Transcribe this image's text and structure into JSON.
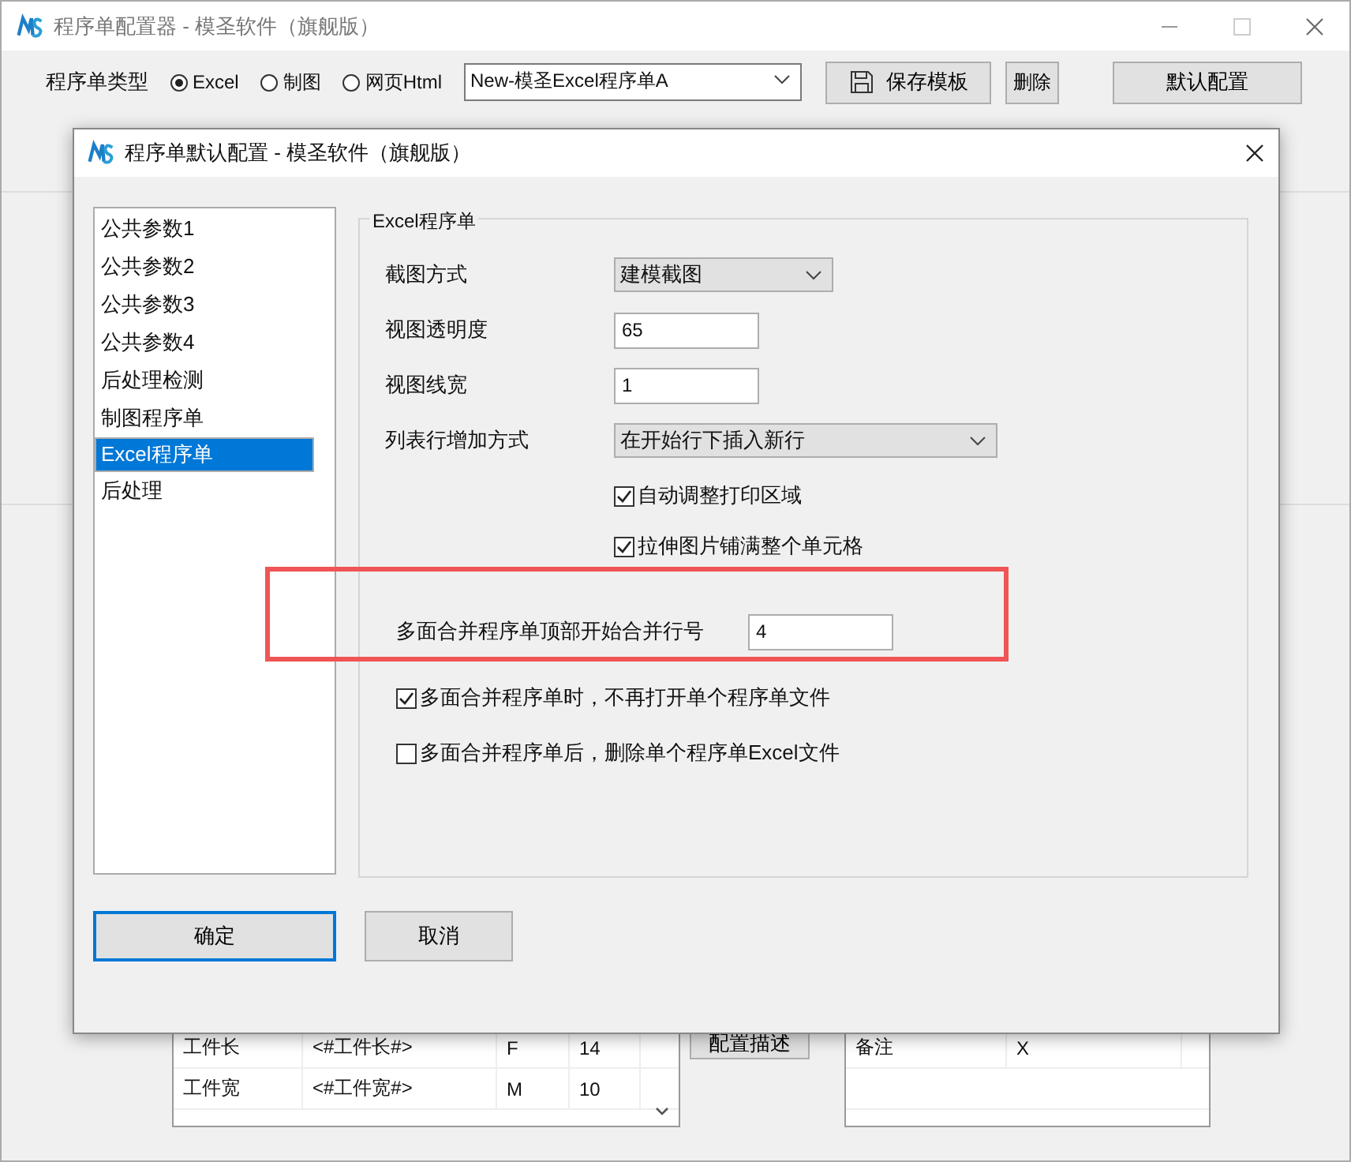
{
  "window": {
    "title": "程序单配置器 - 模圣软件（旗舰版）"
  },
  "toolbar": {
    "type_label": "程序单类型",
    "types": [
      {
        "label": "Excel",
        "selected": true
      },
      {
        "label": "制图",
        "selected": false
      },
      {
        "label": "网页Html",
        "selected": false
      }
    ],
    "template": "New-模圣Excel程序单A",
    "buttons": [
      {
        "label": "保存模板",
        "kind": "save"
      },
      {
        "label": "删除",
        "kind": "small"
      },
      {
        "label": "默认配置",
        "kind": "wide"
      }
    ]
  },
  "params_table": {
    "rows": [
      [
        "工件长",
        "<#工件长#>",
        "F",
        "14"
      ],
      [
        "工件宽",
        "<#工件宽#>",
        "M",
        "10"
      ]
    ]
  },
  "describe_button": "配置描述",
  "notes_table": {
    "rows": [
      [
        "备注",
        "X"
      ]
    ]
  },
  "dialog": {
    "title": "程序单默认配置 - 模圣软件（旗舰版）",
    "nav": [
      {
        "label": "公共参数1",
        "selected": false
      },
      {
        "label": "公共参数2",
        "selected": false
      },
      {
        "label": "公共参数3",
        "selected": false
      },
      {
        "label": "公共参数4",
        "selected": false
      },
      {
        "label": "后处理检测",
        "selected": false
      },
      {
        "label": "制图程序单",
        "selected": false
      },
      {
        "label": "Excel程序单",
        "selected": true
      },
      {
        "label": "后处理",
        "selected": false
      }
    ],
    "group_title": "Excel程序单",
    "fields": [
      {
        "kind": "select",
        "label": "截图方式",
        "value": "建模截图"
      },
      {
        "kind": "input",
        "label": "视图透明度",
        "value": "65"
      },
      {
        "kind": "input",
        "label": "视图线宽",
        "value": "1"
      },
      {
        "kind": "wide_select",
        "label": "列表行增加方式",
        "value": "在开始行下插入新行"
      },
      {
        "kind": "option_checkbox",
        "label": "自动调整打印区域",
        "checked": true
      },
      {
        "kind": "option_checkbox",
        "label": "拉伸图片铺满整个单元格",
        "checked": true
      },
      {
        "kind": "highlighted_input",
        "label": "多面合并程序单顶部开始合并行号",
        "value": "4"
      },
      {
        "kind": "checkbox",
        "label": "多面合并程序单时，不再打开单个程序单文件",
        "checked": true
      },
      {
        "kind": "checkbox",
        "label": "多面合并程序单后，删除单个程序单Excel文件",
        "checked": false
      }
    ],
    "buttons": [
      {
        "label": "确定",
        "default": true
      },
      {
        "label": "取消",
        "default": false
      }
    ]
  }
}
